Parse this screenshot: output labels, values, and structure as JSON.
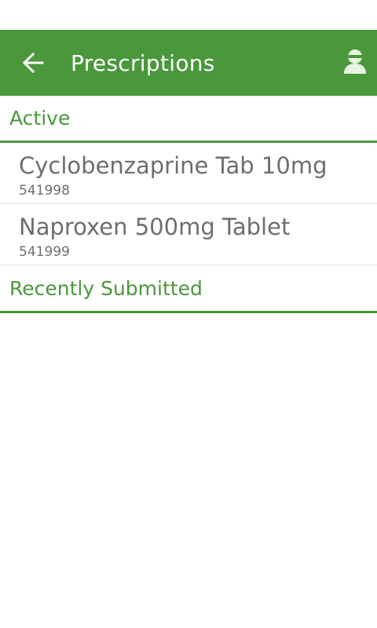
{
  "app_bar": {
    "title": "Prescriptions",
    "back_icon": "back-arrow-icon",
    "profile_icon": "user-profile-icon",
    "color": "#4a973c"
  },
  "sections": {
    "active": {
      "label": "Active",
      "items": [
        {
          "name": "Cyclobenzaprine Tab 10mg",
          "number": "541998"
        },
        {
          "name": "Naproxen 500mg Tablet",
          "number": "541999"
        }
      ]
    },
    "recent": {
      "label": "Recently Submitted"
    }
  }
}
